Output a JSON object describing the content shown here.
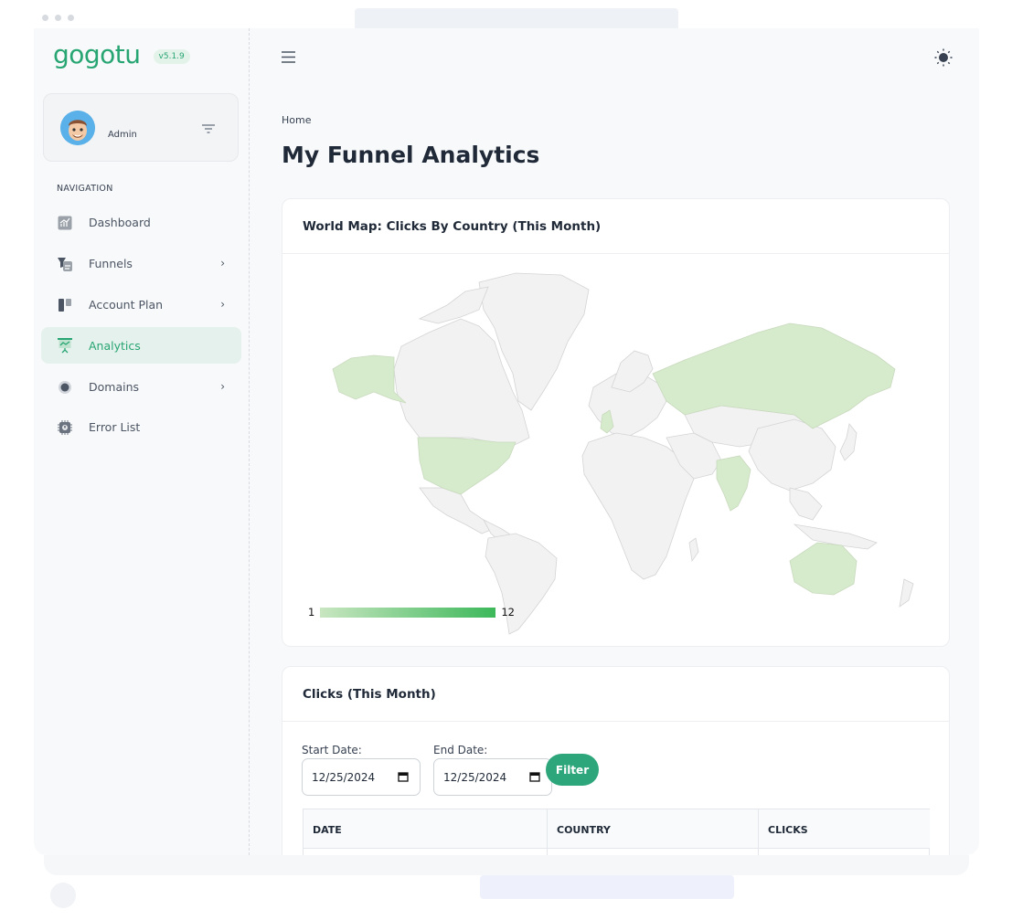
{
  "app": {
    "logo": "gogotu",
    "version": "v5.1.9"
  },
  "profile": {
    "name": "Admin"
  },
  "navigation": {
    "title": "NAVIGATION",
    "items": [
      {
        "label": "Dashboard",
        "icon": "dashboard-icon",
        "has_submenu": false,
        "active": false
      },
      {
        "label": "Funnels",
        "icon": "funnel-icon",
        "has_submenu": true,
        "active": false
      },
      {
        "label": "Account Plan",
        "icon": "account-plan-icon",
        "has_submenu": true,
        "active": false
      },
      {
        "label": "Analytics",
        "icon": "analytics-icon",
        "has_submenu": false,
        "active": true
      },
      {
        "label": "Domains",
        "icon": "domain-icon",
        "has_submenu": true,
        "active": false
      },
      {
        "label": "Error List",
        "icon": "error-icon",
        "has_submenu": false,
        "active": false
      }
    ]
  },
  "header": {
    "breadcrumb": "Home",
    "title": "My Funnel Analytics"
  },
  "map_card": {
    "title": "World Map: Clicks By Country (This Month)",
    "legend_min": "1",
    "legend_max": "12",
    "highlighted_countries": [
      "United States",
      "Alaska (US)",
      "Russia",
      "India",
      "Australia",
      "United Kingdom"
    ],
    "highlight_color": "#d6ebcc",
    "base_color": "#f2f2f2"
  },
  "clicks_card": {
    "title": "Clicks (This Month)",
    "start_label": "Start Date:",
    "start_value": "12/25/2024",
    "end_label": "End Date:",
    "end_value": "12/25/2024",
    "filter_label": "Filter",
    "columns": [
      "DATE",
      "COUNTRY",
      "CLICKS"
    ]
  },
  "colors": {
    "accent": "#27a572",
    "active_bg": "#e5f1ec"
  }
}
